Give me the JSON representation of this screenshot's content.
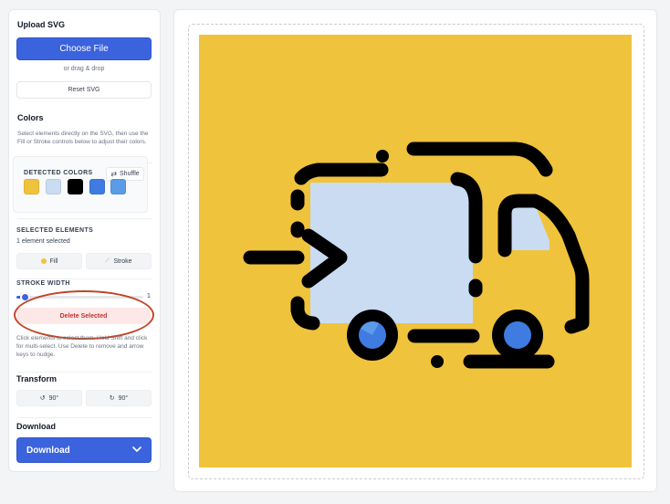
{
  "upload": {
    "title": "Upload SVG",
    "choose_file": "Choose File",
    "drag_drop": "or drag & drop",
    "reset": "Reset SVG"
  },
  "colors": {
    "title": "Colors",
    "hint": "Select elements directly on the SVG, then use the Fill or Stroke controls below to adjust their colors.",
    "detected_title": "DETECTED COLORS",
    "shuffle": "Shuffle",
    "swatches": [
      "#f0c33c",
      "#c9dcf2",
      "#000000",
      "#3f7be0",
      "#5b9be8"
    ]
  },
  "selected": {
    "title": "SELECTED ELEMENTS",
    "count": "1 element selected",
    "fill": "Fill",
    "stroke": "Stroke"
  },
  "stroke_width": {
    "title": "STROKE WIDTH",
    "value": "1"
  },
  "delete_selected": "Delete Selected",
  "help": "Click elements to select them. Hold Shift and click for multi-select. Use Delete to remove and arrow keys to nudge.",
  "transform": {
    "title": "Transform",
    "rotate_left": "90°",
    "rotate_right": "90°"
  },
  "download": {
    "title": "Download",
    "button": "Download"
  },
  "artwork": {
    "background": "#f0c33c",
    "icon": "delivery-truck-icon"
  }
}
